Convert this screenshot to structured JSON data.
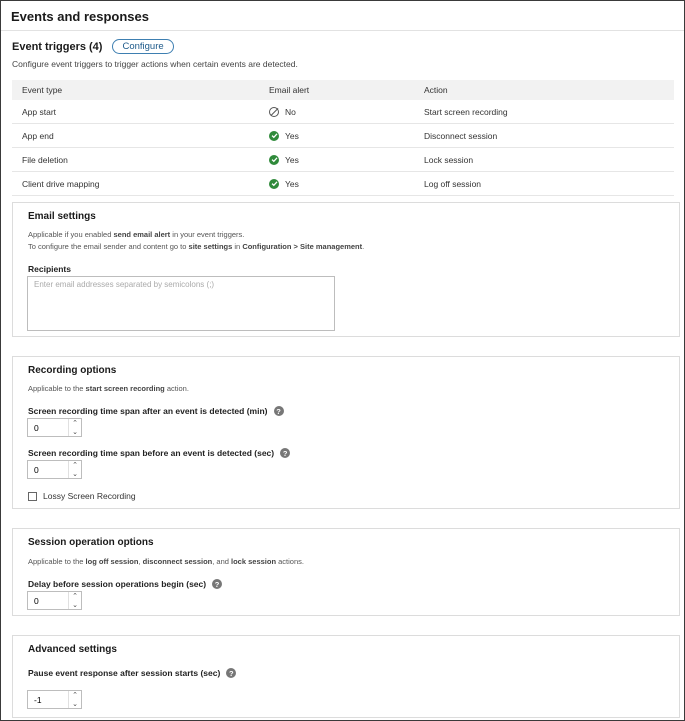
{
  "header": {
    "title": "Events and responses"
  },
  "triggers": {
    "title": "Event triggers (4)",
    "configure_label": "Configure",
    "description": "Configure event triggers to trigger actions when certain events are detected.",
    "columns": [
      "Event type",
      "Email alert",
      "Action"
    ],
    "rows": [
      {
        "event": "App start",
        "alert": "No",
        "alert_icon": "disabled-icon",
        "action": "Start screen recording"
      },
      {
        "event": "App end",
        "alert": "Yes",
        "alert_icon": "check-circle-icon",
        "action": "Disconnect session"
      },
      {
        "event": "File deletion",
        "alert": "Yes",
        "alert_icon": "check-circle-icon",
        "action": "Lock session"
      },
      {
        "event": "Client drive mapping",
        "alert": "Yes",
        "alert_icon": "check-circle-icon",
        "action": "Log off session"
      }
    ]
  },
  "email": {
    "title": "Email settings",
    "note1_pre": "Applicable if you enabled ",
    "note1_bold": "send email alert",
    "note1_post": " in your event triggers.",
    "note2_pre": "To configure the email sender and content go to ",
    "note2_bold1": "site settings",
    "note2_mid": " in ",
    "note2_bold2": "Configuration > Site management",
    "note2_post": ".",
    "recipients_label": "Recipients",
    "recipients_placeholder": "Enter email addresses separated by semicolons (;)"
  },
  "recording": {
    "title": "Recording options",
    "note_pre": "Applicable to the ",
    "note_bold": "start screen recording",
    "note_post": " action.",
    "after_label": "Screen recording time span after an event is detected (min)",
    "after_value": "0",
    "before_label": "Screen recording time span before an event is detected (sec)",
    "before_value": "0",
    "lossy_label": "Lossy Screen Recording"
  },
  "session": {
    "title": "Session operation options",
    "note_pre": "Applicable to the ",
    "note_b1": "log off session",
    "note_sep1": ", ",
    "note_b2": "disconnect session",
    "note_sep2": ", and ",
    "note_b3": "lock session",
    "note_post": " actions.",
    "delay_label": "Delay before session operations begin (sec)",
    "delay_value": "0"
  },
  "advanced": {
    "title": "Advanced settings",
    "pause_label": "Pause event response after session starts (sec)",
    "pause_value": "-1"
  },
  "colors": {
    "accent": "#3e7fb1",
    "success": "#2f8a3a",
    "border": "#dcdcdc"
  }
}
